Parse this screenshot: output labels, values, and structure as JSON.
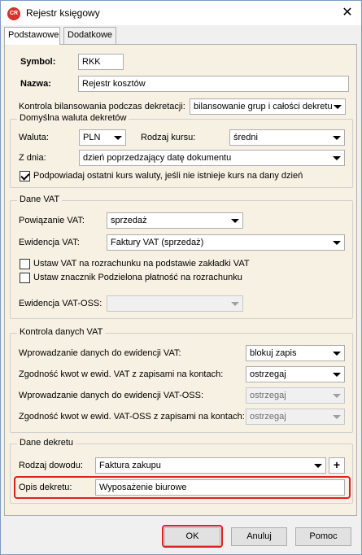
{
  "window": {
    "title": "Rejestr księgowy",
    "icon_text": "CR",
    "close_symbol": "✕"
  },
  "tabs": [
    {
      "label": "Podstawowe",
      "active": true
    },
    {
      "label": "Dodatkowe",
      "active": false
    }
  ],
  "symbol": {
    "label": "Symbol:",
    "value": "RKK"
  },
  "nazwa": {
    "label": "Nazwa:",
    "value": "Rejestr kosztów"
  },
  "kontrola_bilansowania": {
    "label": "Kontrola bilansowania podczas dekretacji:",
    "value": "bilansowanie grup i całości dekretu"
  },
  "waluta_group": {
    "title": "Domyślna waluta dekretów",
    "waluta_label": "Waluta:",
    "waluta_value": "PLN",
    "rodzaj_kursu_label": "Rodzaj kursu:",
    "rodzaj_kursu_value": "średni",
    "z_dnia_label": "Z dnia:",
    "z_dnia_value": "dzień poprzedzający datę dokumentu",
    "podpowiadaj_label": "Podpowiadaj ostatni kurs waluty, jeśli nie istnieje kurs na dany dzień",
    "podpowiadaj_checked": true
  },
  "vat_group": {
    "title": "Dane VAT",
    "powiazanie_label": "Powiązanie VAT:",
    "powiazanie_value": "sprzedaż",
    "ewidencja_label": "Ewidencja VAT:",
    "ewidencja_value": "Faktury VAT (sprzedaż)",
    "ustaw_vat_label": "Ustaw VAT na rozrachunku na podstawie zakładki VAT",
    "ustaw_vat_checked": false,
    "ustaw_znacznik_label": "Ustaw znacznik Podzielona płatność na rozrachunku",
    "ustaw_znacznik_checked": false,
    "ewidencja_oss_label": "Ewidencja VAT-OSS:",
    "ewidencja_oss_value": ""
  },
  "kontrola_group": {
    "title": "Kontrola danych VAT",
    "row1_label": "Wprowadzanie danych do ewidencji VAT:",
    "row1_value": "blokuj zapis",
    "row2_label": "Zgodność kwot w ewid. VAT z zapisami na kontach:",
    "row2_value": "ostrzegaj",
    "row3_label": "Wprowadzanie danych do ewidencji VAT-OSS:",
    "row3_value": "ostrzegaj",
    "row4_label": "Zgodność kwot w ewid. VAT-OSS z zapisami na kontach:",
    "row4_value": "ostrzegaj"
  },
  "dekret_group": {
    "title": "Dane dekretu",
    "rodzaj_label": "Rodzaj dowodu:",
    "rodzaj_value": "Faktura zakupu",
    "plus_label": "+",
    "opis_label": "Opis dekretu:",
    "opis_value": "Wyposażenie biurowe"
  },
  "buttons": {
    "ok": "OK",
    "anuluj": "Anuluj",
    "pomoc": "Pomoc"
  },
  "colors": {
    "highlight": "#e02020",
    "panel_bg": "#f7f1e3"
  }
}
